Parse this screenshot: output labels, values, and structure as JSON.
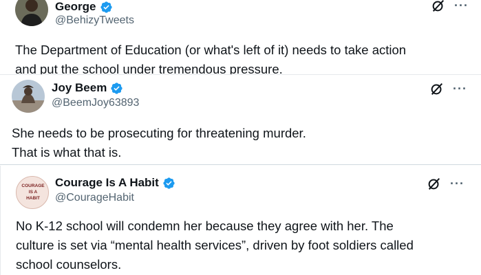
{
  "tweets": [
    {
      "name": "George",
      "handle": "@BehizyTweets",
      "lines": [
        "The Department of Education (or what's left of it) needs to take action",
        "and put the school under tremendous pressure."
      ]
    },
    {
      "name": "Joy Beem",
      "handle": "@BeemJoy63893",
      "lines": [
        "She needs to be prosecuting for threatening murder.",
        "That is what that is."
      ]
    },
    {
      "name": "Courage Is A Habit",
      "handle": "@CourageHabit",
      "avatar_text": [
        "COURAGE",
        "IS A",
        "HABIT"
      ],
      "lines": [
        "No K-12 school will condemn her because they agree with her. The",
        "culture is set via “mental health services”, driven by foot soldiers called",
        "school counselors."
      ]
    }
  ],
  "icons": {
    "verified": "verified-badge-icon",
    "grok": "grok-icon",
    "more": "more-options-icon",
    "more_glyph": "···"
  },
  "colors": {
    "verified": "#1d9bf0",
    "text": "#0f1419",
    "secondary": "#536471"
  }
}
